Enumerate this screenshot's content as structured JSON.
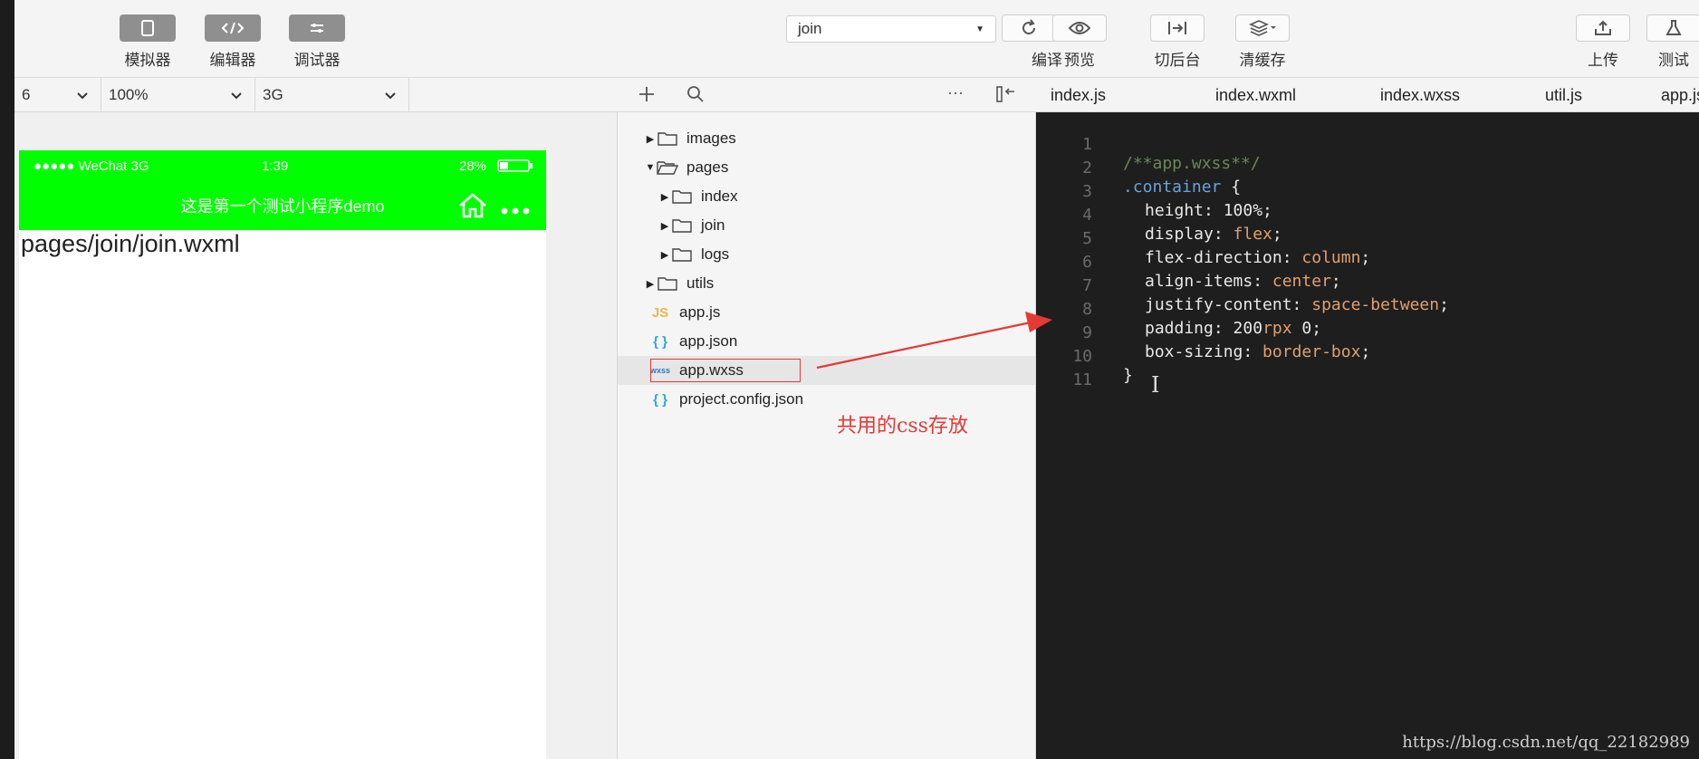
{
  "toolbar": {
    "simulator_label": "模拟器",
    "editor_label": "编辑器",
    "debugger_label": "调试器",
    "project_value": "join",
    "compile_label": "编译",
    "preview_label": "预览",
    "background_label": "切后台",
    "clear_cache_label": "清缓存",
    "upload_label": "上传",
    "test_label": "测试"
  },
  "subbar": {
    "device_value": "6",
    "zoom_value": "100%",
    "network_value": "3G"
  },
  "phone": {
    "signal": "●●●●● WeChat 3G",
    "time": "1:39",
    "battery": "28%",
    "nav_title": "这是第一个测试小程序demo",
    "content": "pages/join/join.wxml"
  },
  "explorer": {
    "more": "···",
    "items": [
      {
        "label": "images"
      },
      {
        "label": "pages"
      },
      {
        "label": "index"
      },
      {
        "label": "join"
      },
      {
        "label": "logs"
      },
      {
        "label": "utils"
      },
      {
        "label": "app.js",
        "badge": "JS"
      },
      {
        "label": "app.json",
        "badge": "{ }"
      },
      {
        "label": "app.wxss",
        "badge": "wxss"
      },
      {
        "label": "project.config.json",
        "badge": "{ }"
      }
    ]
  },
  "annotation": "共用的css存放",
  "tabs": [
    "index.js",
    "index.wxml",
    "index.wxss",
    "util.js",
    "app.js"
  ],
  "code": {
    "line_numbers": [
      "1",
      "2",
      "3",
      "4",
      "5",
      "6",
      "7",
      "8",
      "9",
      "10",
      "11"
    ],
    "l1": "/**app.wxss**/",
    "l2_sel": ".container",
    "l2_brace": " {",
    "l3_prop": "height:",
    "l3_val": " 100%;",
    "l4_prop": "display:",
    "l4_val": " flex",
    "l5_prop": "flex-direction:",
    "l5_val": " column",
    "l6_prop": "align-items:",
    "l6_val": " center",
    "l7_prop": "justify-content:",
    "l7_val": " space-between",
    "l8_prop": "padding:",
    "l8_num": " 200",
    "l8_unit": "rpx",
    "l8_tail": " 0;",
    "l9_prop": "box-sizing:",
    "l9_val": " border-box",
    "semi": ";",
    "l10": "}"
  },
  "watermark": "https://blog.csdn.net/qq_22182989"
}
